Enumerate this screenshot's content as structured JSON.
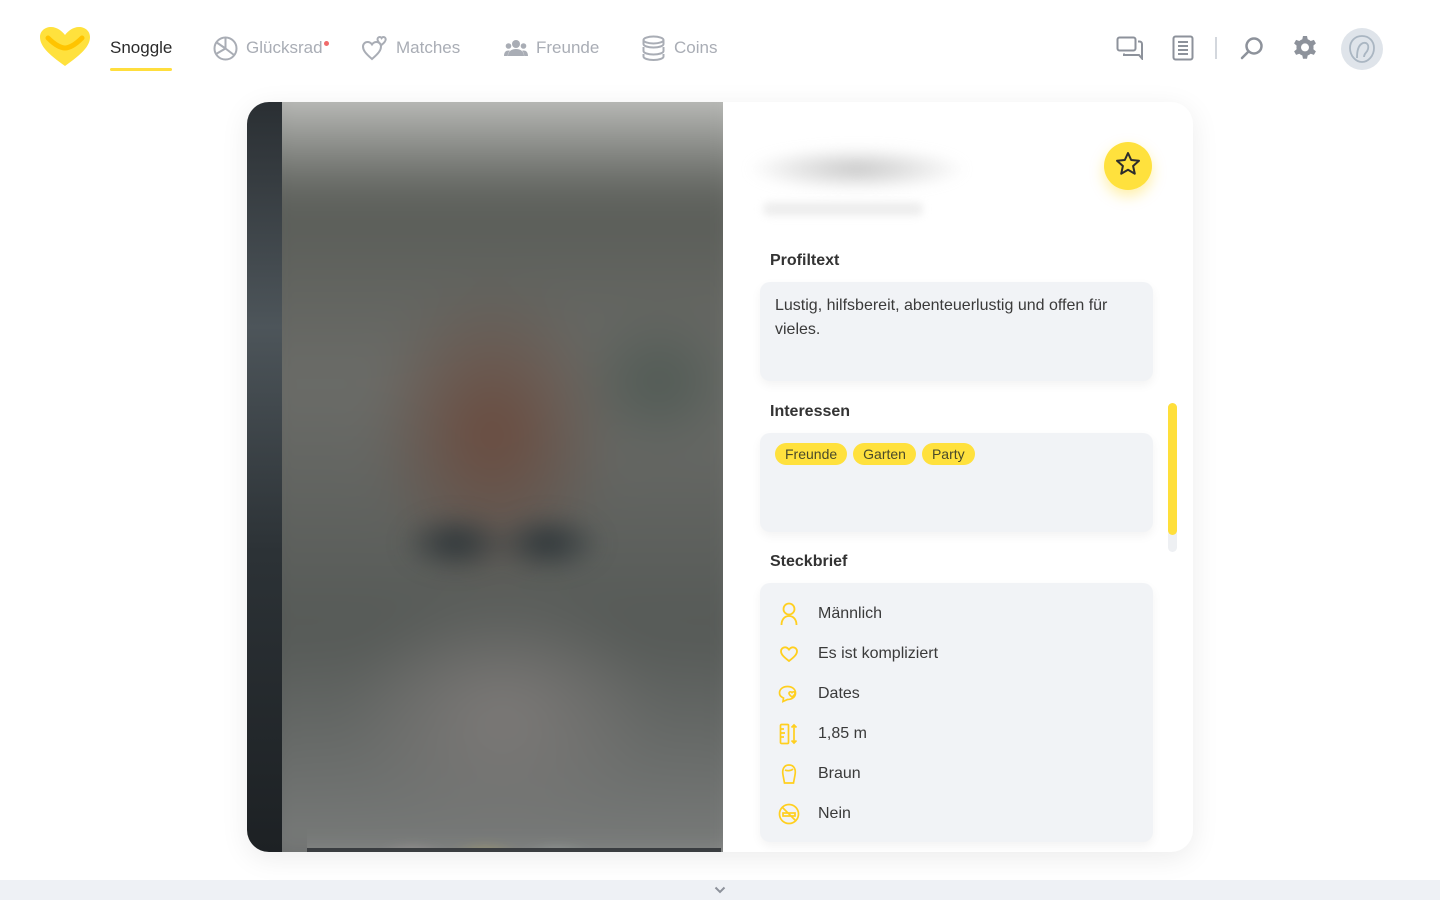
{
  "nav": {
    "brand_label": "Snoggle",
    "items": [
      {
        "label": "Glücksrad",
        "icon": "wheel-icon",
        "has_badge": true
      },
      {
        "label": "Matches",
        "icon": "hearts-icon"
      },
      {
        "label": "Freunde",
        "icon": "friends-icon"
      },
      {
        "label": "Coins",
        "icon": "coins-icon"
      }
    ],
    "right_icons": [
      "chat-icon",
      "notes-icon",
      "search-icon",
      "gear-icon",
      "avatar"
    ]
  },
  "colors": {
    "accent": "#ffde3d",
    "badge": "#f06a6a",
    "icon_gray": "#a9adb5",
    "box_bg": "#f1f3f6"
  },
  "profile": {
    "profiltext_title": "Profiltext",
    "profiltext": "Lustig, hilfsbereit, abenteuerlustig und offen für vieles.",
    "interessen_title": "Interessen",
    "interessen": [
      "Freunde",
      "Garten",
      "Party"
    ],
    "steckbrief_title": "Steckbrief",
    "steckbrief": [
      {
        "icon": "person-icon",
        "value": "Männlich"
      },
      {
        "icon": "heart-icon",
        "value": "Es ist kompliziert"
      },
      {
        "icon": "speech-hearts-icon",
        "value": "Dates"
      },
      {
        "icon": "height-icon",
        "value": "1,85 m"
      },
      {
        "icon": "hair-icon",
        "value": "Braun"
      },
      {
        "icon": "no-smoking-icon",
        "value": "Nein"
      }
    ]
  }
}
